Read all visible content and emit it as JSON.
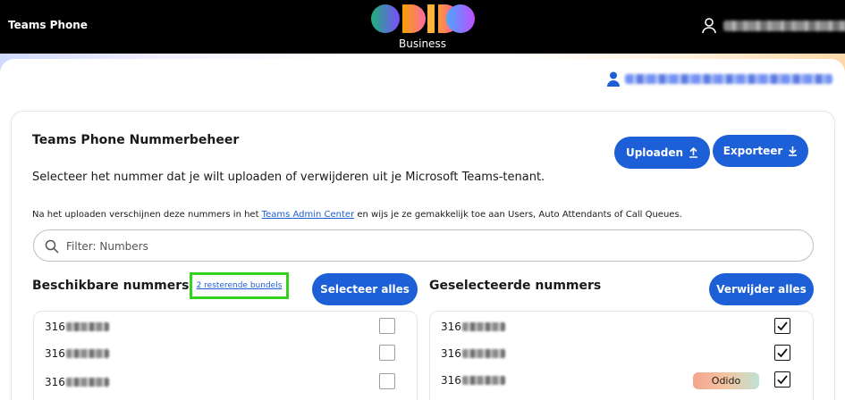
{
  "header": {
    "app_title": "Teams Phone",
    "logo_text": "odido",
    "logo_subtitle": "Business"
  },
  "card": {
    "title": "Teams Phone Nummerbeheer",
    "subtitle": "Selecteer het nummer dat je wilt uploaden of verwijderen uit je Microsoft Teams-tenant.",
    "hint_before": "Na het uploaden verschijnen deze nummers in het ",
    "hint_link": "Teams Admin Center",
    "hint_after": " en wijs je ze gemakkelijk toe aan Users, Auto Attendants of Call Queues.",
    "upload_label": "Uploaden",
    "export_label": "Exporteer"
  },
  "search": {
    "placeholder": "Filter: Numbers",
    "value": ""
  },
  "available": {
    "title": "Beschikbare nummers",
    "bundles_label": "2 resterende bundels",
    "select_all_label": "Selecteer alles",
    "rows": [
      {
        "prefix": "316",
        "checked": false
      },
      {
        "prefix": "316",
        "checked": false
      },
      {
        "prefix": "316",
        "checked": false
      }
    ]
  },
  "selected": {
    "title": "Geselecteerde nummers",
    "remove_all_label": "Verwijder alles",
    "rows": [
      {
        "prefix": "316",
        "checked": true,
        "badge": ""
      },
      {
        "prefix": "316",
        "checked": true,
        "badge": ""
      },
      {
        "prefix": "316",
        "checked": true,
        "badge": "Odido"
      }
    ]
  },
  "colors": {
    "primary": "#1d5fd6",
    "highlight_border": "#34d11f",
    "topbar": "#000000"
  },
  "icons": [
    "user-icon",
    "upload-icon",
    "download-icon",
    "search-icon",
    "checkmark-icon"
  ]
}
